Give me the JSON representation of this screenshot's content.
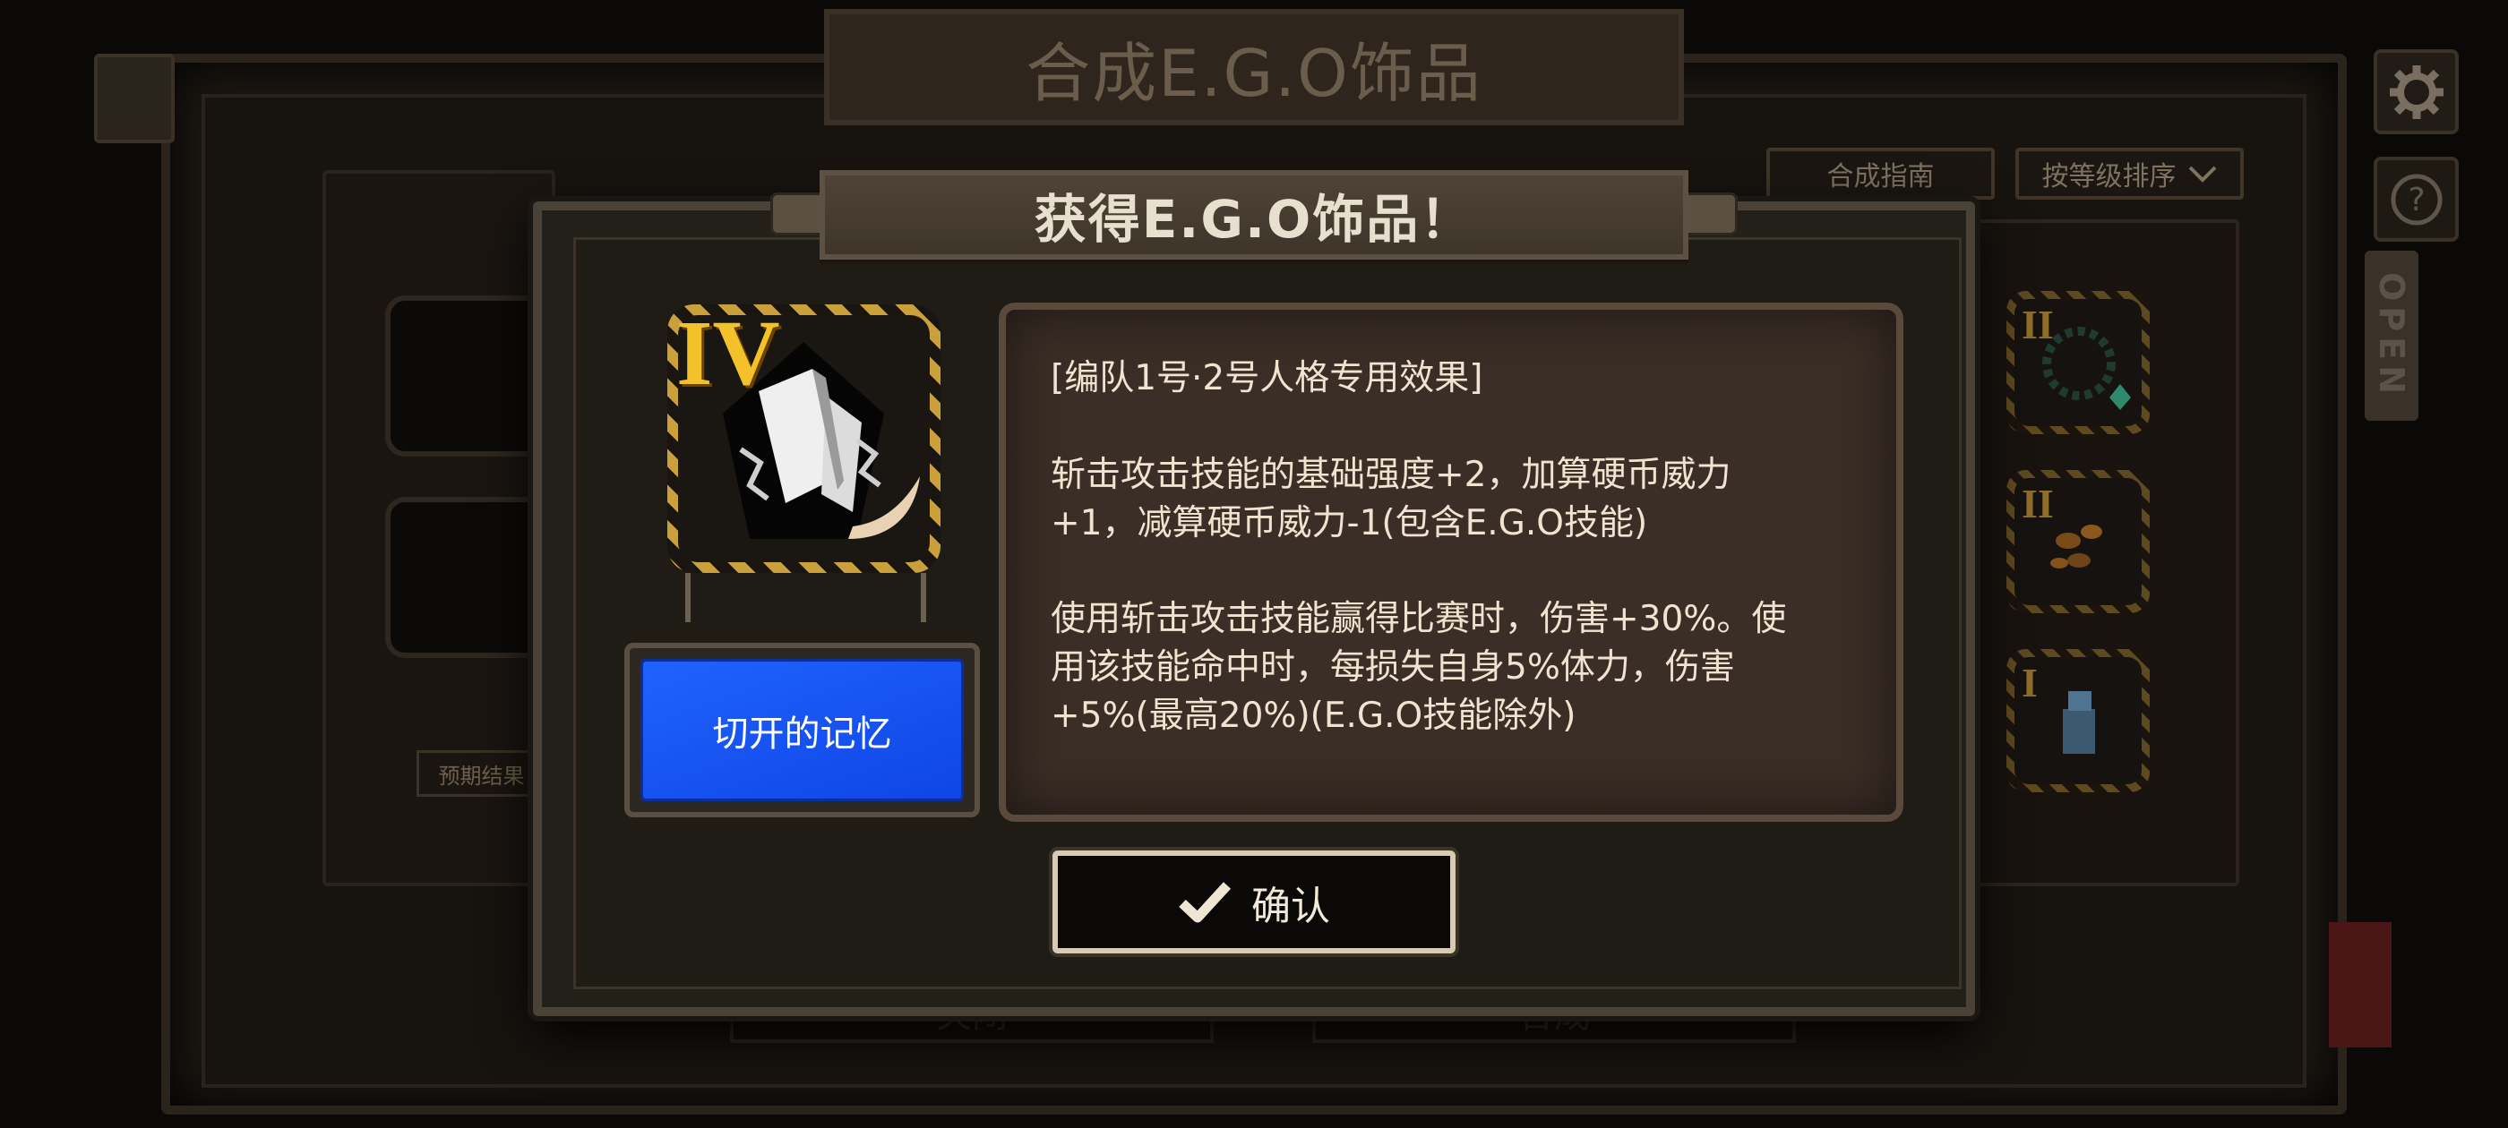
{
  "background": {
    "title": "合成E.G.O饰品",
    "guide_button": "合成指南",
    "sort_button": "按等级排序",
    "expected_result_label": "预期结果",
    "open_label": "OPEN",
    "list_items": [
      {
        "grade": "II",
        "icon": "thorn-wreath-icon"
      },
      {
        "grade": "II",
        "icon": "butterflies-icon"
      },
      {
        "grade": "I",
        "icon": "lighter-icon"
      }
    ],
    "bottom_left_button": "关闭",
    "bottom_right_button": "合成"
  },
  "modal": {
    "title": "获得E.G.O饰品！",
    "ego": {
      "grade": "IV",
      "icon": "shattered-blades-icon",
      "name": "切开的记忆"
    },
    "description": {
      "line1": "[编队1号·2号人格专用效果]",
      "para1_a": "斩击攻击技能的基础强度+2，加算硬币威力",
      "para1_b": "+1，减算硬币威力-1(包含E.G.O技能)",
      "para2_a": "使用斩击攻击技能赢得比赛时，伤害+30%。使",
      "para2_b": "用该技能命中时，每损失自身5%体力，伤害",
      "para2_c": "+5%(最高20%)(E.G.O技能除外)"
    },
    "confirm_label": "确认"
  },
  "colors": {
    "accent_blue": "#1f63ff",
    "grade_gold": "#f3c12a",
    "text_cream": "#f1e3cf"
  }
}
